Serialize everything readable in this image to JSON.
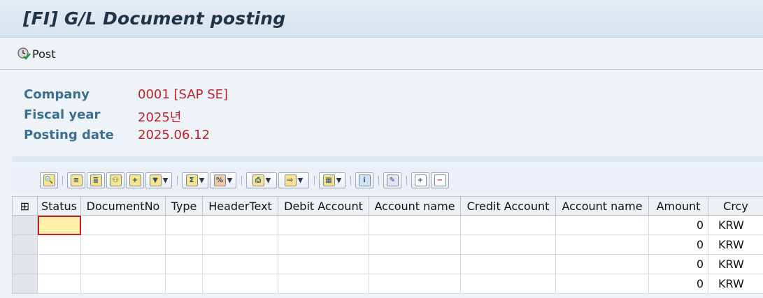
{
  "window": {
    "title": "[FI] G/L Document posting"
  },
  "toolbar": {
    "post_label": "Post"
  },
  "header": {
    "company_label": "Company",
    "company_value": "0001 [SAP SE]",
    "fiscal_year_label": "Fiscal year",
    "fiscal_year_value": "2025년",
    "posting_date_label": "Posting date",
    "posting_date_value": "2025.06.12"
  },
  "alv_toolbar": {
    "buttons": [
      "details-icon",
      "sort-ascending-icon",
      "sort-descending-icon",
      "find-icon",
      "find-next-icon",
      "filter-icon",
      "sum-icon",
      "subtotal-icon",
      "print-icon",
      "export-icon",
      "layout-icon",
      "info-icon",
      "graphic-icon",
      "insert-row-icon",
      "delete-row-icon"
    ]
  },
  "table": {
    "columns": [
      "Status",
      "DocumentNo",
      "Type",
      "HeaderText",
      "Debit Account",
      "Account name",
      "Credit Account",
      "Account name",
      "Amount",
      "Crcy"
    ],
    "rows": [
      {
        "Status": "",
        "DocumentNo": "",
        "Type": "",
        "HeaderText": "",
        "Debit": "",
        "DebitName": "",
        "Credit": "",
        "CreditName": "",
        "Amount": "0",
        "Crcy": "KRW"
      },
      {
        "Status": "",
        "DocumentNo": "",
        "Type": "",
        "HeaderText": "",
        "Debit": "",
        "DebitName": "",
        "Credit": "",
        "CreditName": "",
        "Amount": "0",
        "Crcy": "KRW"
      },
      {
        "Status": "",
        "DocumentNo": "",
        "Type": "",
        "HeaderText": "",
        "Debit": "",
        "DebitName": "",
        "Credit": "",
        "CreditName": "",
        "Amount": "0",
        "Crcy": "KRW"
      },
      {
        "Status": "",
        "DocumentNo": "",
        "Type": "",
        "HeaderText": "",
        "Debit": "",
        "DebitName": "",
        "Credit": "",
        "CreditName": "",
        "Amount": "0",
        "Crcy": "KRW"
      }
    ]
  },
  "colors": {
    "label": "#3a6f8f",
    "value": "#c0202a",
    "title": "#1f3448",
    "active_cell": "#fef0a8"
  }
}
